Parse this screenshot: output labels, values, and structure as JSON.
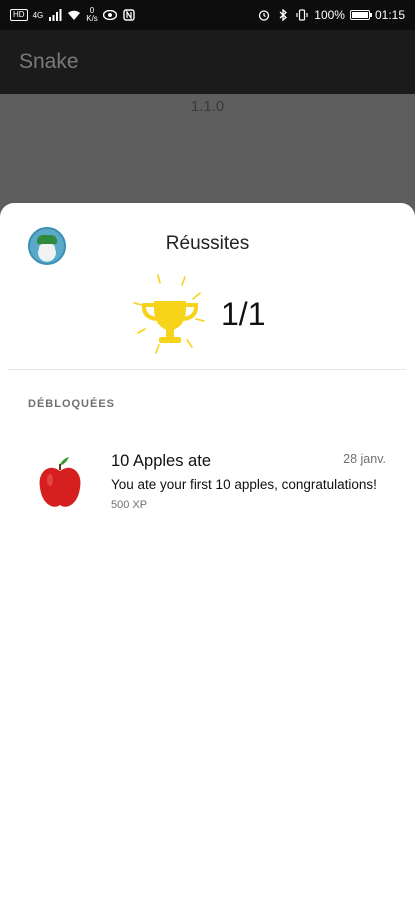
{
  "status_bar": {
    "left_chip": "HD",
    "network": "4G",
    "speed_value": "0",
    "speed_unit": "K/s",
    "battery_percent": "100%",
    "battery_level": 1.0,
    "time": "01:15",
    "icons": [
      "signal-icon",
      "wifi-icon",
      "eye-icon",
      "nfc-icon",
      "alarm-icon",
      "bluetooth-icon",
      "vibrate-icon",
      "battery-icon"
    ]
  },
  "app_bar": {
    "title": "Snake"
  },
  "background": {
    "version": "1.1.0"
  },
  "achievements": {
    "title": "Réussites",
    "progress": "1/1",
    "section_label": "DÉBLOQUÉES",
    "items": [
      {
        "icon": "apple-icon",
        "name": "10 Apples ate",
        "date": "28 janv.",
        "description": "You ate your first 10 apples, congratulations!",
        "xp": "500 XP"
      }
    ]
  },
  "colors": {
    "trophy": "#f7d31a",
    "apple": "#d61f1f",
    "sheet": "#ffffff",
    "scrim": "#5e5e5e"
  }
}
